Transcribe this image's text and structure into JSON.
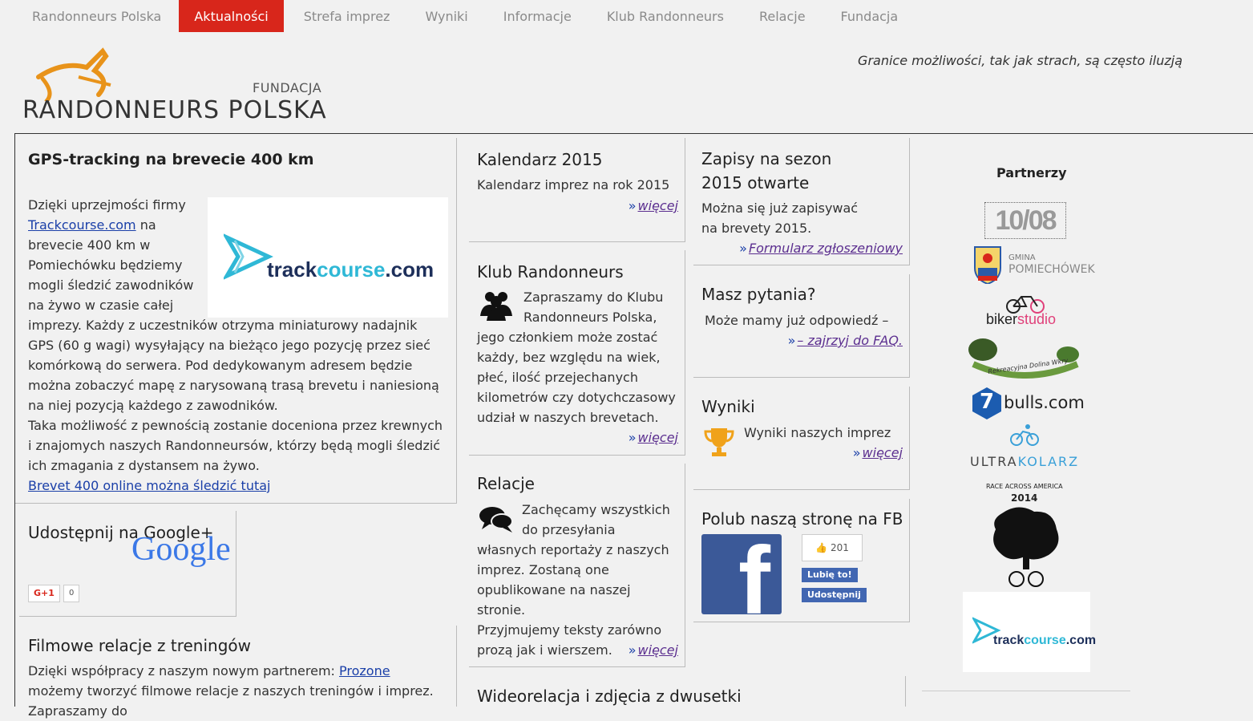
{
  "nav": {
    "items": [
      "Randonneurs Polska",
      "Aktualności",
      "Strefa imprez",
      "Wyniki",
      "Informacje",
      "Klub Randonneurs",
      "Relacje",
      "Fundacja"
    ]
  },
  "logo": {
    "foundation": "FUNDACJA",
    "name": "RANDONNEURS POLSKA"
  },
  "motto": "Granice możliwości, tak jak strach, są często iluzją",
  "gps": {
    "title": "GPS-tracking na brevecie 400 km",
    "p1_pre": "Dzięki uprzejmości firmy ",
    "p1_link": "Trackcourse.com",
    "p1_post": " na brevecie 400 km w Pomiechówku będziemy mogli śledzić zawodników na żywo w czasie całej imprezy. Każdy z uczestników otrzyma miniaturowy nadajnik GPS (60 g wagi) wysyłający na bieżąco jego pozycję przez sieć komórkową do serwera. Pod dedykowanym adresem będzie można zobaczyć mapę z  narysowaną trasą brevetu i naniesioną na niej pozycją każdego z zawodników.",
    "p2": "Taka możliwość z pewnością zostanie doceniona przez krewnych i znajomych naszych Randonneursów, którzy będą mogli śledzić ich zmagania z dystansem na żywo.",
    "link": "Brevet 400 online można śledzić tutaj",
    "logo_a": "track",
    "logo_b": "course",
    "logo_c": ".com"
  },
  "gplus": {
    "title": "Udostępnij na Google+",
    "brand": "Google",
    "button": "G+1",
    "count": "0"
  },
  "film": {
    "title": "Filmowe relacje z treningów",
    "text_pre": "Dzięki współpracy z naszym nowym partnerem: ",
    "link": "Prozone",
    "text_post": " możemy tworzyć filmowe relacje z naszych treningów i imprez. Zapraszamy do"
  },
  "kalendarz": {
    "title": "Kalendarz 2015",
    "text": "Kalendarz imprez na rok 2015",
    "more": "więcej"
  },
  "klub": {
    "title": "Klub Randonneurs",
    "text": "Zapraszamy do Klubu Randonneurs Polska, jego członkiem może zostać każdy, bez względu na wiek, płeć, ilość przejechanych kilometrów czy dotychczasowy udział w naszych brevetach.",
    "more": "więcej"
  },
  "relacje": {
    "title": "Relacje",
    "text": "Zachęcamy wszystkich do przesyłania własnych reportaży z naszych imprez. Zostaną one opublikowane na naszej stronie.",
    "text2": "Przyjmujemy teksty zarówno prozą jak i wierszem.",
    "more": "więcej"
  },
  "wideo": {
    "title": "Wideorelacja i zdjęcia z dwusetki"
  },
  "zapisy": {
    "title": "Zapisy na sezon 2015 otwarte",
    "text": "Można się już zapisywać na brevety 2015.",
    "more": "Formularz zgłoszeniowy"
  },
  "pytania": {
    "title": "Masz pytania?",
    "text": "Może mamy już odpowiedź –",
    "more": "– zajrzyj do FAQ."
  },
  "wyniki": {
    "title": "Wyniki",
    "text": "Wyniki naszych imprez",
    "more": "więcej"
  },
  "fb": {
    "title": "Polub naszą stronę na FB",
    "count": "201",
    "like": "Lubię to!",
    "share": "Udostępnij"
  },
  "sidebar": {
    "title": "Partnerzy",
    "p1": "10/08",
    "p2a": "GMINA",
    "p2b": "POMIECHÓWEK",
    "p3a": "biker",
    "p3b": "studio",
    "p4": "Rekreacyjna Dolina Wkry",
    "p5": "bulls.com",
    "p5n": "7",
    "p6a": "ULTRA",
    "p6b": "KOLARZ",
    "p7a": "RACE ACROSS AMERICA",
    "p7b": "2014",
    "p8a": "track",
    "p8b": "course",
    "p8c": ".com"
  },
  "colors": {
    "accent": "#d8261b",
    "link": "#1a3fa8",
    "more": "#5b2e8f",
    "facebook": "#3b5998",
    "orange": "#e8931a"
  }
}
